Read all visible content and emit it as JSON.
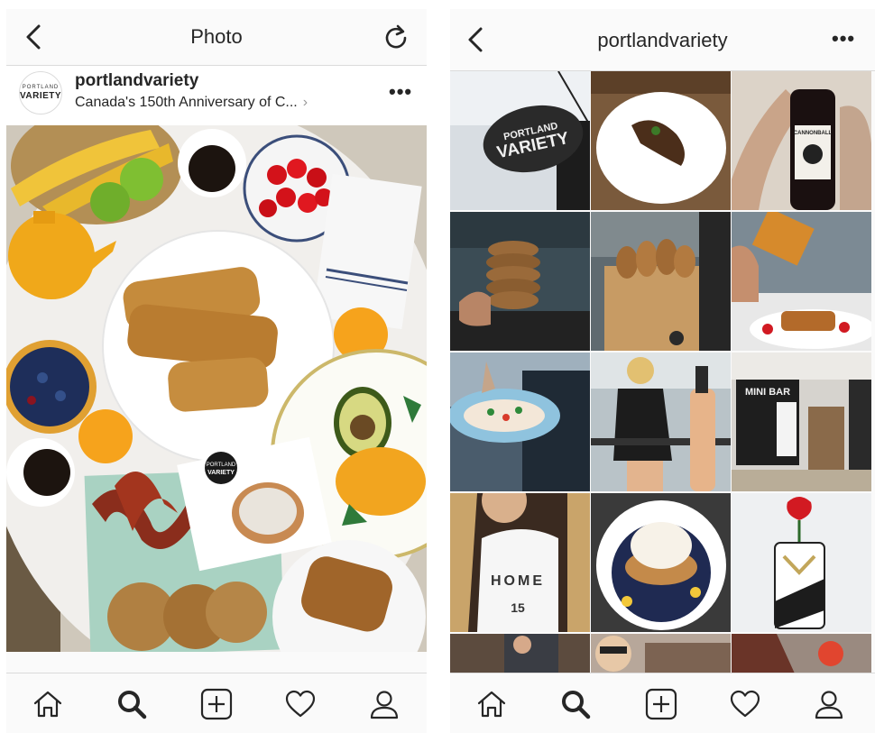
{
  "left_screen": {
    "header": {
      "title": "Photo",
      "back_icon": "chevron-left-icon",
      "refresh_icon": "refresh-icon"
    },
    "post": {
      "username": "portlandvariety",
      "location": "Canada's 150th Anniversary of C...",
      "avatar_text_top": "PORTLAND",
      "avatar_text_bottom": "VARIETY",
      "options_label": "•••"
    },
    "photo": {
      "description_icon": "breakfast-spread-photo",
      "sticker_top": "PORTLAND",
      "sticker_bottom": "VARIETY"
    },
    "tab_bar": [
      "home-icon",
      "search-icon",
      "add-icon",
      "heart-icon",
      "profile-icon"
    ]
  },
  "right_screen": {
    "header": {
      "title": "portlandvariety",
      "back_icon": "chevron-left-icon",
      "options_label": "•••"
    },
    "grid": {
      "sign_top": "PORTLAND",
      "sign_bottom": "VARIETY",
      "bottle_label": "CANNONBALL",
      "shirt_text": "HOME",
      "shirt_number": "15",
      "minibar_sign": "MINI BAR"
    },
    "tab_bar": [
      "home-icon",
      "search-icon",
      "add-icon",
      "heart-icon",
      "profile-icon"
    ]
  },
  "colors": {
    "icon": "#262626",
    "divider": "#dbdbdb",
    "background": "#fafafa"
  }
}
